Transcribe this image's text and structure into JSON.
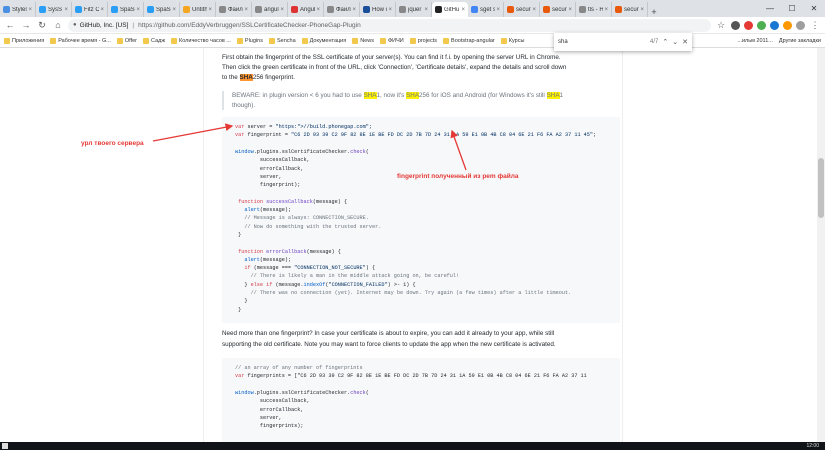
{
  "tabs": [
    {
      "label": "Styles",
      "color": "#4a90e2"
    },
    {
      "label": "SysS",
      "color": "#2a9df4"
    },
    {
      "label": "Fitz C",
      "color": "#2a9df4"
    },
    {
      "label": "SpaSc",
      "color": "#2a9df4"
    },
    {
      "label": "SpaSc",
      "color": "#2a9df4"
    },
    {
      "label": "Untith",
      "color": "#f5a623"
    },
    {
      "label": "Файл",
      "color": "#888888"
    },
    {
      "label": "angul",
      "color": "#888888"
    },
    {
      "label": "Angul",
      "color": "#dd3333"
    },
    {
      "label": "Файл",
      "color": "#888888"
    },
    {
      "label": "How c",
      "color": "#1c4f99"
    },
    {
      "label": "jquer",
      "color": "#888888"
    },
    {
      "label": "GitHu",
      "color": "#222222",
      "active": true
    },
    {
      "label": "sget s",
      "color": "#4285f4"
    },
    {
      "label": "securi",
      "color": "#e8590c"
    },
    {
      "label": "securi",
      "color": "#e8590c"
    },
    {
      "label": "tls - H",
      "color": "#888888"
    },
    {
      "label": "securi",
      "color": "#e8590c"
    }
  ],
  "tab_close": "×",
  "new_tab": "+",
  "window_controls": {
    "min": "—",
    "max": "☐",
    "close": "✕"
  },
  "toolbar": {
    "back": "←",
    "forward": "→",
    "reload": "↻",
    "home": "⌂",
    "lock": "🔒",
    "org": "GitHub, Inc. [US]",
    "sep": "|",
    "url": "https://github.com/EddyVerbruggen/SSLCertificateChecker-PhoneGap-Plugin",
    "star": "☆",
    "menu": "⋮"
  },
  "bookmarks": [
    "Приложения",
    "Рабочее время - G...",
    "Offer",
    "Садж",
    "Количество часов ...",
    "Plugins",
    "Sencha",
    "Документация",
    "News",
    "ФИЧИ",
    "projects",
    "Bootstrap-angular",
    "Курсы"
  ],
  "bookmarks_right": [
    "...ильм 2011...",
    "Другие закладки"
  ],
  "find": {
    "query": "sha",
    "count": "4/7",
    "up": "⌃",
    "down": "⌄",
    "close": "✕"
  },
  "page": {
    "intro_1": "First obtain the fingerprint of the SSL certificate of your server(s). You can find it f.i. by opening the server URL in Chrome.",
    "intro_2": "Then click the green certificate in front of the URL, click 'Connection', 'Certificate details', expand the details and scroll down",
    "intro_3a": "to the ",
    "intro_3_hl": "SHA",
    "intro_3b": "256 fingerprint.",
    "beware_a": "BEWARE: in plugin version < 6 you had to use ",
    "beware_hl1": "SHA",
    "beware_b": "1, now it's ",
    "beware_hl2": "SHA",
    "beware_c": "256 for iOS and Android (for Windows it's still ",
    "beware_hl3": "SHA",
    "beware_d": "1",
    "beware_e": "though).",
    "multi_1": "Need more than one fingerprint? In case your certificate is about to expire, you can add it already to your app, while still",
    "multi_2": "supporting the old certificate. Note you may want to force clients to update the app when the new certificate is activated."
  },
  "code1": [
    {
      "t": "var server = \"https://build.phonegap.com\";"
    },
    {
      "t": "var fingerprint = \"C6 2D 93 39 C2 9F 82 8E 1E BE FD DC 2D 7B 7D 24 31 1A 59 E1 0B 4B C8 04 6E 21 F6 FA A2 37 11 45\";"
    },
    {
      "t": ""
    },
    {
      "t": "window.plugins.sslCertificateChecker.check("
    },
    {
      "t": "        successCallback,"
    },
    {
      "t": "        errorCallback,"
    },
    {
      "t": "        server,"
    },
    {
      "t": "        fingerprint);"
    },
    {
      "t": ""
    },
    {
      "t": " function successCallback(message) {"
    },
    {
      "t": "   alert(message);"
    },
    {
      "t": "   // Message is always: CONNECTION_SECURE."
    },
    {
      "t": "   // Now do something with the trusted server."
    },
    {
      "t": " }"
    },
    {
      "t": ""
    },
    {
      "t": " function errorCallback(message) {"
    },
    {
      "t": "   alert(message);"
    },
    {
      "t": "   if (message === \"CONNECTION_NOT_SECURE\") {"
    },
    {
      "t": "     // There is likely a man in the middle attack going on, be careful!"
    },
    {
      "t": "   } else if (message.indexOf(\"CONNECTION_FAILED\") >- 1) {"
    },
    {
      "t": "     // There was no connection (yet). Internet may be down. Try again (a few times) after a little timeout."
    },
    {
      "t": "   }"
    },
    {
      "t": " }"
    }
  ],
  "code2": [
    {
      "t": "// an array of any number of fingerprints"
    },
    {
      "t": "var fingerprints = [\"C6 2D 93 39 C2 9F 82 8E 1E BE FD DC 2D 7B 7D 24 31 1A 59 E1 0B 4B C8 04 6E 21 F6 FA A2 37 11"
    },
    {
      "t": ""
    },
    {
      "t": "window.plugins.sslCertificateChecker.check("
    },
    {
      "t": "        successCallback,"
    },
    {
      "t": "        errorCallback,"
    },
    {
      "t": "        server,"
    },
    {
      "t": "        fingerprints);"
    }
  ],
  "annotations": {
    "server_note": "урл твоего сервера",
    "fingerprint_note": "fingerprint полученный из pem файла",
    "color": "#e53935"
  },
  "taskbar_clock": "12:00"
}
